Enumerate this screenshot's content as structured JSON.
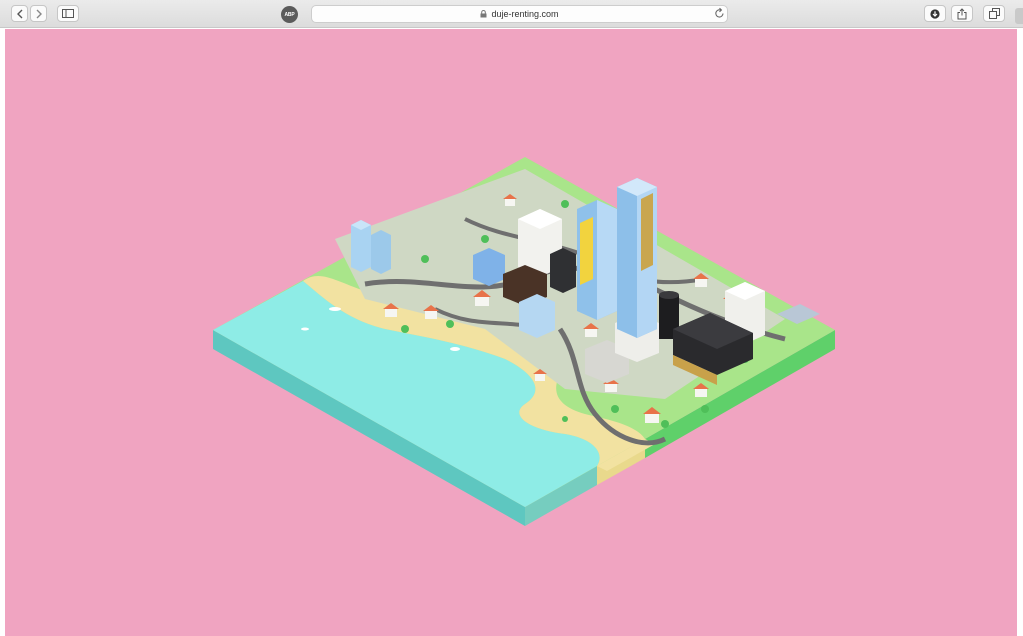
{
  "browser": {
    "url": "duje-renting.com",
    "adblock_label": "ABP",
    "icons": [
      "back-icon",
      "forward-icon",
      "sidebar-icon",
      "lock-icon",
      "reload-icon",
      "download-icon",
      "share-icon",
      "tabs-icon"
    ]
  },
  "page": {
    "background_color": "#f0a4c1",
    "scene": "isometric-city-map",
    "colors": {
      "sea_top": "#8eece6",
      "sea_side": "#5ec7c0",
      "land_top": "#a9e58a",
      "land_side": "#5fd06a",
      "sand": "#f2e2a1"
    }
  }
}
